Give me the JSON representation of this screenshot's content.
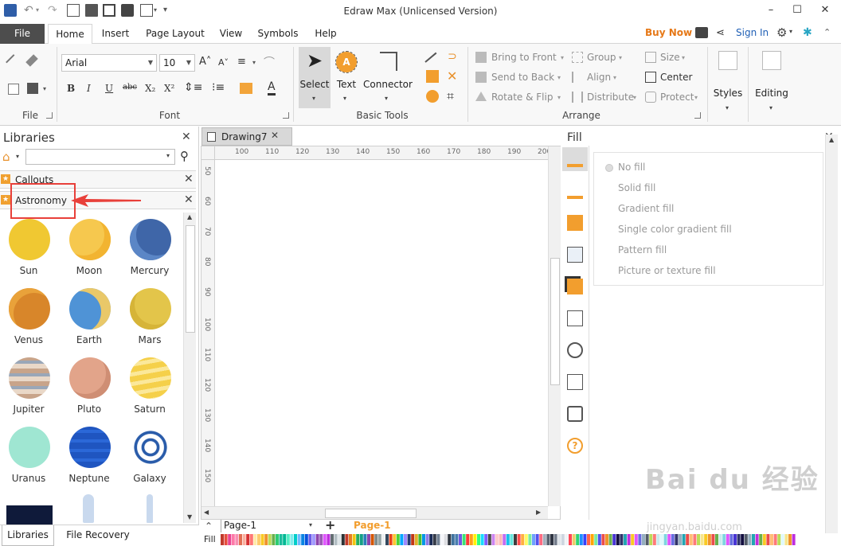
{
  "app": {
    "title": "Edraw Max (Unlicensed Version)",
    "window_controls": [
      "minimize",
      "maximize",
      "close"
    ]
  },
  "menu": {
    "file": "File",
    "tabs": [
      "Home",
      "Insert",
      "Page Layout",
      "View",
      "Symbols",
      "Help"
    ],
    "active_tab": "Home",
    "buy_now": "Buy Now",
    "sign_in": "Sign In"
  },
  "ribbon": {
    "file_group_label": "File",
    "font": {
      "family": "Arial",
      "size": "10",
      "group_label": "Font",
      "buttons": [
        "B",
        "I",
        "U",
        "abc",
        "X₂",
        "X²"
      ]
    },
    "basic_tools": {
      "group_label": "Basic Tools",
      "select": "Select",
      "text": "Text",
      "connector": "Connector"
    },
    "arrange": {
      "group_label": "Arrange",
      "bring_to_front": "Bring to Front",
      "send_to_back": "Send to Back",
      "rotate_flip": "Rotate & Flip",
      "group": "Group",
      "align": "Align",
      "distribute": "Distribute",
      "size": "Size",
      "center": "Center",
      "protect": "Protect"
    },
    "styles": "Styles",
    "editing": "Editing"
  },
  "libraries": {
    "title": "Libraries",
    "search_value": "",
    "categories": [
      "Callouts",
      "Astronomy"
    ],
    "shapes": [
      {
        "label": "Sun",
        "color": "#f0c832"
      },
      {
        "label": "Moon",
        "color": "#f6c84e"
      },
      {
        "label": "Mercury",
        "color": "#3f66a8"
      },
      {
        "label": "Venus",
        "color": "#d8862a"
      },
      {
        "label": "Earth",
        "color": "#4f93d6"
      },
      {
        "label": "Mars",
        "color": "#e3c54a"
      },
      {
        "label": "Jupiter",
        "color": "#c8a48a"
      },
      {
        "label": "Pluto",
        "color": "#e2a48a"
      },
      {
        "label": "Saturn",
        "color": "#f5d04a"
      },
      {
        "label": "Uranus",
        "color": "#9fe6d2"
      },
      {
        "label": "Neptune",
        "color": "#1f55c0"
      },
      {
        "label": "Galaxy",
        "color": "#2a5caa"
      }
    ],
    "bottom_tabs": [
      "Libraries",
      "File Recovery"
    ]
  },
  "document": {
    "tab_name": "Drawing7",
    "hruler_ticks": [
      "100",
      "110",
      "120",
      "130",
      "140",
      "150",
      "160",
      "170",
      "180",
      "190",
      "200"
    ],
    "vruler_ticks": [
      "50",
      "60",
      "70",
      "80",
      "90",
      "100",
      "110",
      "120",
      "130",
      "140",
      "150"
    ]
  },
  "fill_panel": {
    "title": "Fill",
    "options": [
      "No fill",
      "Solid fill",
      "Gradient fill",
      "Single color gradient fill",
      "Pattern fill",
      "Picture or texture fill"
    ]
  },
  "pagebar": {
    "page_select": "Page-1",
    "active_page": "Page-1",
    "fill_label": "Fill"
  },
  "watermark": {
    "main": "Bai du 经验",
    "sub": "jingyan.baidu.com"
  },
  "palette": [
    "#c0392b",
    "#e74c3c",
    "#e84393",
    "#fd79a8",
    "#f78fb3",
    "#e17055",
    "#fab1a0",
    "#d63031",
    "#ff7675",
    "#ffeaa7",
    "#fdcb6e",
    "#f9ca24",
    "#f0932b",
    "#badc58",
    "#6ab04c",
    "#2ecc71",
    "#1abc9c",
    "#00b894",
    "#55efc4",
    "#81ecec",
    "#00cec9",
    "#74b9ff",
    "#0984e3",
    "#0652dd",
    "#6c5ce7",
    "#a29bfe",
    "#8e44ad",
    "#9b59b6",
    "#e056fd",
    "#be2edd",
    "#636e72",
    "#b2bec3",
    "#dfe6e9",
    "#2d3436",
    "#c0392b",
    "#e67e22",
    "#f1c40f",
    "#27ae60",
    "#16a085",
    "#2980b9",
    "#8e44ad",
    "#d35400",
    "#7f8c8d",
    "#95a5a6",
    "#ecf0f1",
    "#34495e",
    "#e84118",
    "#fbc531",
    "#4cd137",
    "#00a8ff",
    "#9c88ff",
    "#273c75",
    "#c23616",
    "#e1b12c",
    "#44bd32",
    "#0097e6",
    "#8c7ae6",
    "#192a56",
    "#353b48",
    "#718093",
    "#f5f6fa",
    "#dcdde1",
    "#2f3640",
    "#40739e",
    "#487eb0",
    "#7158e2",
    "#3ae374",
    "#ff3838",
    "#ff9f1a",
    "#fff200",
    "#32ff7e",
    "#18dcff",
    "#7d5fff",
    "#4b4b4b",
    "#cd84f1",
    "#ffcccc",
    "#ffb8b8",
    "#c56cf0",
    "#17c0eb",
    "#67e6dc",
    "#3d3d3d",
    "#ff4d4d",
    "#ffaf40",
    "#fffa65",
    "#7bed9f",
    "#70a1ff",
    "#5352ed",
    "#ff6b81",
    "#a4b0be",
    "#57606f",
    "#2f3542",
    "#747d8c",
    "#dfe4ea",
    "#ced6e0",
    "#f1f2f6",
    "#ff4757",
    "#eccc68",
    "#2ed573",
    "#1e90ff",
    "#3742fa",
    "#ff6348",
    "#ffa502",
    "#7bed9f",
    "#5352ed",
    "#eb4d4b",
    "#f0932b",
    "#6ab04c",
    "#4834d4",
    "#130f40",
    "#30336b",
    "#22a6b3",
    "#be2edd",
    "#f9ca24",
    "#e056fd",
    "#686de0",
    "#95afc0",
    "#535c68",
    "#badc58",
    "#ff7979",
    "#c7ecee",
    "#dff9fb",
    "#7ed6df",
    "#e056fd",
    "#686de0",
    "#30336b",
    "#95afc0",
    "#22a6b3",
    "#eb4d4b",
    "#ffbe76",
    "#ff7979",
    "#badc58",
    "#f6e58d",
    "#f9ca24",
    "#f0932b",
    "#eb4d4b",
    "#6ab04c",
    "#c7ecee",
    "#7ed6df",
    "#e056fd",
    "#686de0",
    "#4834d4",
    "#30336b",
    "#130f40",
    "#535c68",
    "#95afc0",
    "#22a6b3",
    "#be2edd",
    "#6ab04c",
    "#f9ca24",
    "#eb4d4b",
    "#ffbe76",
    "#ff7979",
    "#badc58",
    "#dff9fb",
    "#f6e58d",
    "#f0932b",
    "#be2edd"
  ]
}
